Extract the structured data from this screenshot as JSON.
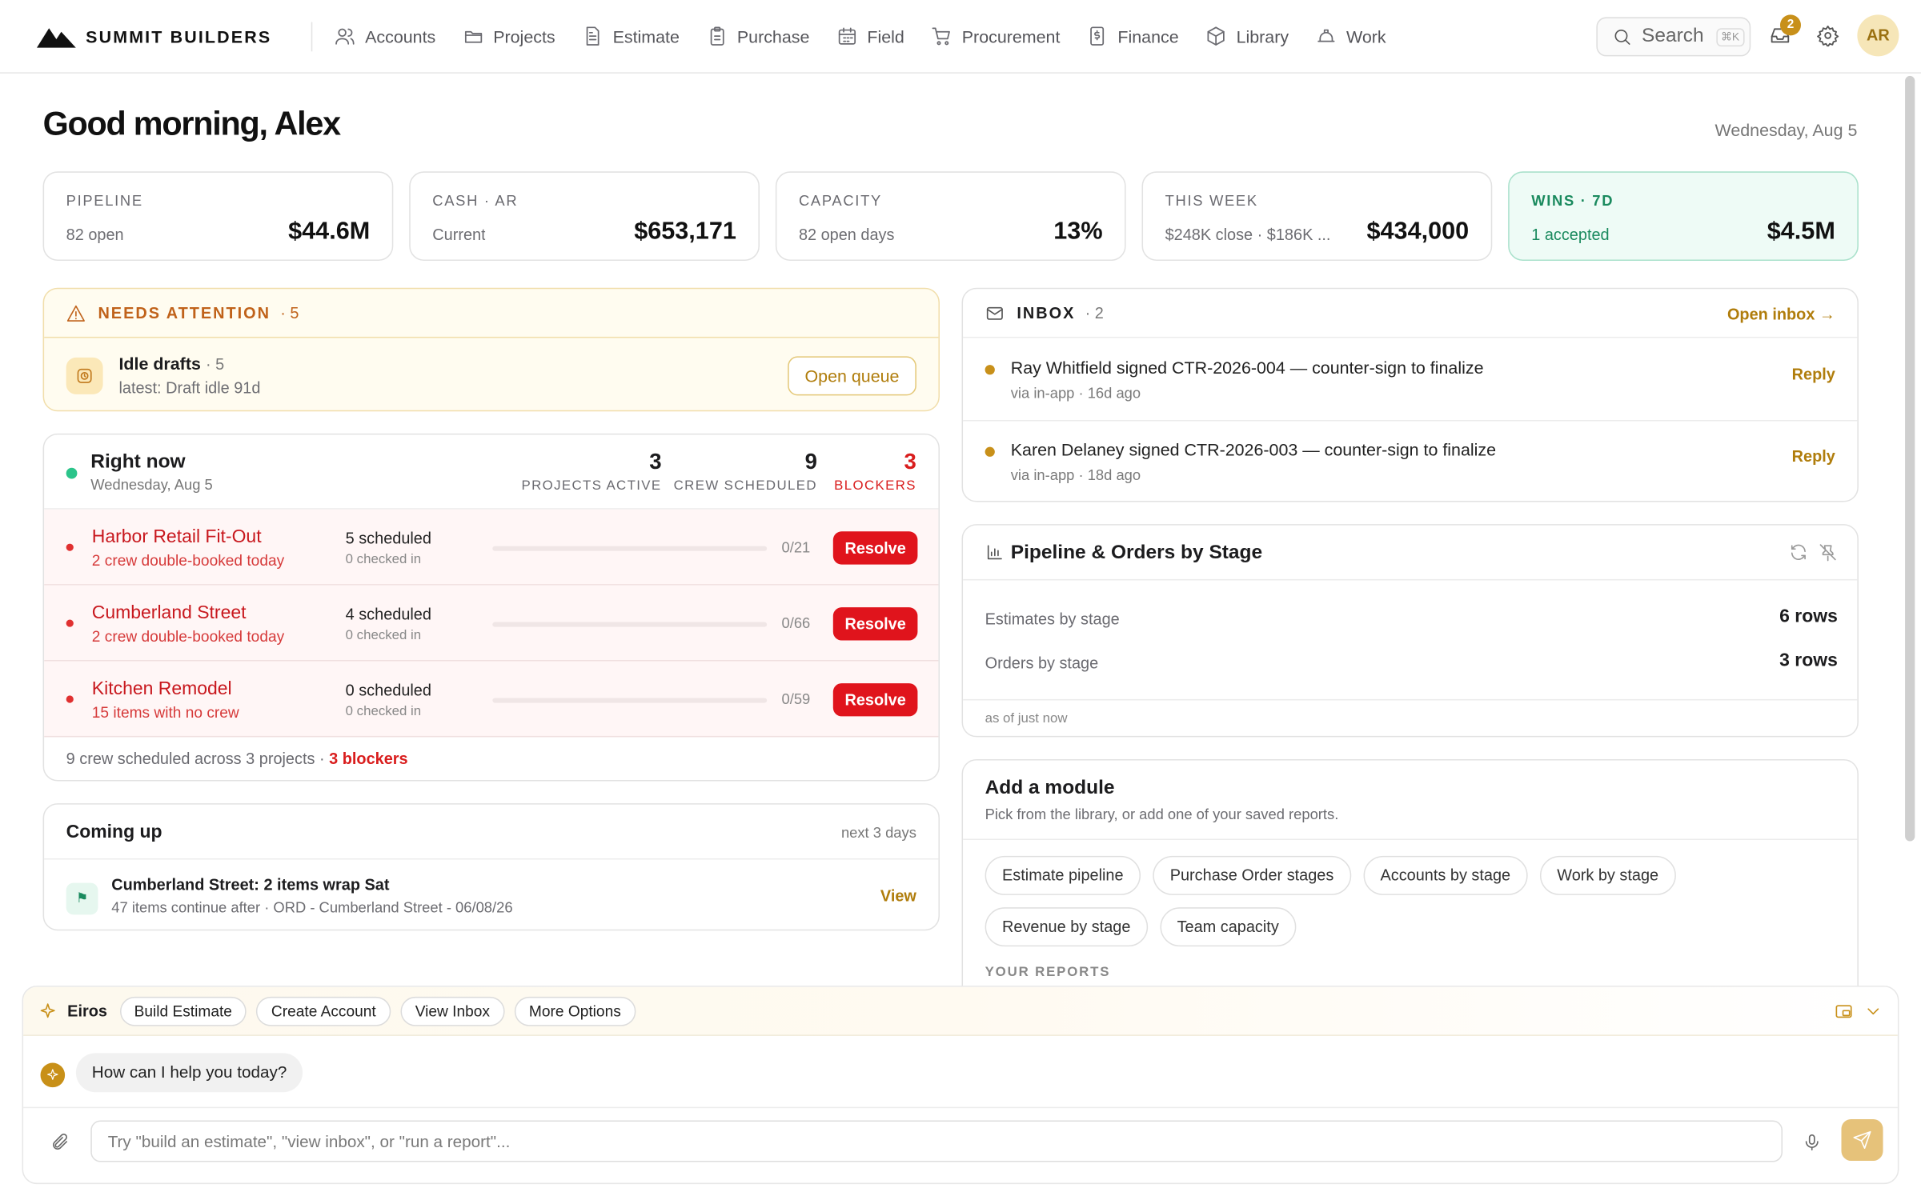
{
  "brand": {
    "name": "SUMMIT BUILDERS"
  },
  "nav": [
    {
      "label": "Accounts",
      "icon": "users-icon"
    },
    {
      "label": "Projects",
      "icon": "folder-icon"
    },
    {
      "label": "Estimate",
      "icon": "document-icon"
    },
    {
      "label": "Purchase",
      "icon": "clipboard-icon"
    },
    {
      "label": "Field",
      "icon": "calendar-icon"
    },
    {
      "label": "Procurement",
      "icon": "cart-icon"
    },
    {
      "label": "Finance",
      "icon": "dollar-file-icon"
    },
    {
      "label": "Library",
      "icon": "cube-icon"
    },
    {
      "label": "Work",
      "icon": "hardhat-icon"
    }
  ],
  "topbar": {
    "search_label": "Search",
    "search_shortcut": "⌘K",
    "notification_count": "2",
    "avatar_initials": "AR"
  },
  "greeting": "Good morning, Alex",
  "date": "Wednesday, Aug 5",
  "kpis": [
    {
      "label": "PIPELINE",
      "sub": "82 open",
      "value": "$44.6M"
    },
    {
      "label": "CASH · AR",
      "sub": "Current",
      "value": "$653,171"
    },
    {
      "label": "CAPACITY",
      "sub": "82 open days",
      "value": "13%"
    },
    {
      "label": "THIS WEEK",
      "sub": "$248K close · $186K ...",
      "value": "$434,000"
    },
    {
      "label": "WINS · 7D",
      "sub": "1 accepted",
      "value": "$4.5M"
    }
  ],
  "attention": {
    "title": "NEEDS ATTENTION",
    "count": "· 5",
    "item_title": "Idle drafts",
    "item_count": "· 5",
    "item_sub": "latest: Draft idle 91d",
    "button": "Open queue"
  },
  "right_now": {
    "title": "Right now",
    "date": "Wednesday, Aug 5",
    "stats": [
      {
        "value": "3",
        "label": "PROJECTS ACTIVE"
      },
      {
        "value": "9",
        "label": "CREW SCHEDULED"
      },
      {
        "value": "3",
        "label": "BLOCKERS"
      }
    ],
    "rows": [
      {
        "name": "Harbor Retail Fit-Out",
        "issue": "2 crew double-booked today",
        "scheduled": "5 scheduled",
        "checked": "0 checked in",
        "progress": "0/21",
        "action": "Resolve"
      },
      {
        "name": "Cumberland Street",
        "issue": "2 crew double-booked today",
        "scheduled": "4 scheduled",
        "checked": "0 checked in",
        "progress": "0/66",
        "action": "Resolve"
      },
      {
        "name": "Kitchen Remodel",
        "issue": "15 items with no crew",
        "scheduled": "0 scheduled",
        "checked": "0 checked in",
        "progress": "0/59",
        "action": "Resolve"
      }
    ],
    "footer_text": "9 crew scheduled across 3 projects ·",
    "footer_blockers": "3 blockers"
  },
  "coming_up": {
    "title": "Coming up",
    "range": "next 3 days",
    "item_title": "Cumberland Street: 2 items wrap Sat",
    "item_sub": "47 items continue after · ORD - Cumberland Street - 06/08/26",
    "action": "View"
  },
  "inbox": {
    "title": "INBOX",
    "count": "· 2",
    "open_label": "Open inbox →",
    "messages": [
      {
        "text": "Ray Whitfield signed CTR-2026-004 — counter-sign to finalize",
        "meta": "via in-app · 16d ago",
        "action": "Reply"
      },
      {
        "text": "Karen Delaney signed CTR-2026-003 — counter-sign to finalize",
        "meta": "via in-app · 18d ago",
        "action": "Reply"
      }
    ]
  },
  "pipeline": {
    "title": "Pipeline & Orders by Stage",
    "rows": [
      {
        "label": "Estimates by stage",
        "value": "6 rows"
      },
      {
        "label": "Orders by stage",
        "value": "3 rows"
      }
    ],
    "footer": "as of just now"
  },
  "module": {
    "title": "Add a module",
    "subtitle": "Pick from the library, or add one of your saved reports.",
    "chips": [
      "Estimate pipeline",
      "Purchase Order stages",
      "Accounts by stage",
      "Work by stage",
      "Revenue by stage",
      "Team capacity"
    ],
    "reports_label": "YOUR REPORTS"
  },
  "assistant": {
    "name": "Eiros",
    "quick_actions": [
      "Build Estimate",
      "Create Account",
      "View Inbox",
      "More Options"
    ],
    "message": "How can I help you today?",
    "input_placeholder": "Try \"build an estimate\", \"view inbox\", or \"run a report\"..."
  },
  "colors": {
    "accent": "#c8901a",
    "danger": "#e0141c",
    "success": "#1a8a5e",
    "warning": "#c0621a"
  }
}
